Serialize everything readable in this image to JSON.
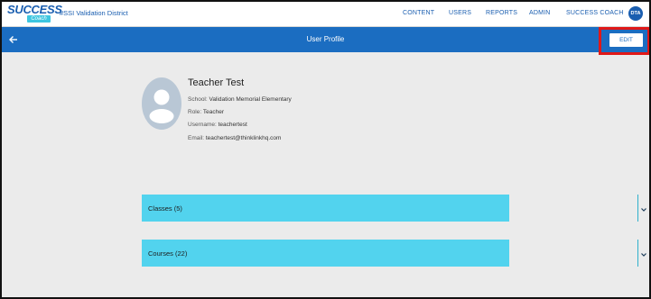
{
  "header": {
    "logo_text": "SUCCESS",
    "logo_sub": "Coach",
    "district": "#SSI Validation District",
    "nav": [
      {
        "label": "CONTENT"
      },
      {
        "label": "USERS"
      },
      {
        "label": "REPORTS"
      },
      {
        "label": "ADMIN"
      },
      {
        "label": "SUCCESS COACH"
      }
    ],
    "user_initials": "DTA"
  },
  "titlebar": {
    "back_icon": "arrow-left-icon",
    "title": "User Profile",
    "edit_label": "EDIT"
  },
  "profile": {
    "avatar_icon": "user-silhouette-icon",
    "name": "Teacher Test",
    "school_label": "School:",
    "school": "Validation Memorial Elementary",
    "role_label": "Role:",
    "role": "Teacher",
    "username_label": "Username:",
    "username": "teachertest",
    "email_label": "Email:",
    "email": "teachertest@thinklinkhq.com"
  },
  "sections": [
    {
      "label": "Classes (5)",
      "icon": "chevron-down-icon"
    },
    {
      "label": "Courses (22)",
      "icon": "chevron-down-icon"
    }
  ],
  "colors": {
    "brand_blue": "#1b6dc1",
    "accordion_cyan": "#52d3ee",
    "highlight_red": "#e01818",
    "page_bg": "#ebebeb"
  }
}
